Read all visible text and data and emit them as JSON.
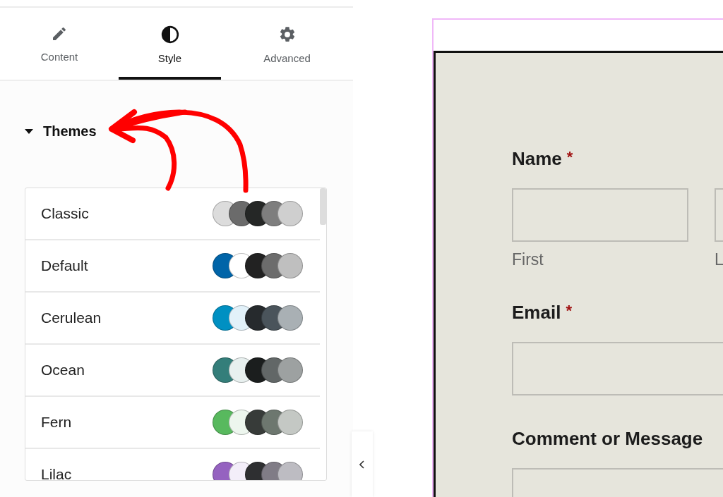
{
  "tabs": [
    {
      "label": "Content",
      "selected": false
    },
    {
      "label": "Style",
      "selected": true
    },
    {
      "label": "Advanced",
      "selected": false
    }
  ],
  "section": {
    "title": "Themes",
    "expanded": true
  },
  "themes": [
    {
      "name": "Classic",
      "swatches": [
        {
          "color": "#dcdcdc"
        },
        {
          "color": "#6b6b6b"
        },
        {
          "color": "#252726"
        },
        {
          "color": "#7e7e7e"
        },
        {
          "color": "#cfcfcf"
        }
      ]
    },
    {
      "name": "Default",
      "swatches": [
        {
          "color": "#0064a8"
        },
        {
          "color": "#ffffff"
        },
        {
          "color": "#222222"
        },
        {
          "color": "#6c6c6c"
        },
        {
          "color": "#bfbfbf"
        }
      ]
    },
    {
      "name": "Cerulean",
      "swatches": [
        {
          "color": "#0090c2"
        },
        {
          "color": "#e2f1f9"
        },
        {
          "color": "#262a2d"
        },
        {
          "color": "#4a545b"
        },
        {
          "color": "#a9b0b4"
        }
      ]
    },
    {
      "name": "Ocean",
      "swatches": [
        {
          "color": "#347e7a"
        },
        {
          "color": "#e8f0ef"
        },
        {
          "color": "#1b1e1e"
        },
        {
          "color": "#626767"
        },
        {
          "color": "#9da1a1"
        }
      ]
    },
    {
      "name": "Fern",
      "swatches": [
        {
          "color": "#58b95e"
        },
        {
          "color": "#edf6ee"
        },
        {
          "color": "#373b39"
        },
        {
          "color": "#6d776f"
        },
        {
          "color": "#c4c8c4"
        }
      ]
    },
    {
      "name": "Lilac",
      "swatches": [
        {
          "color": "#9562c0"
        },
        {
          "color": "#f3eef9"
        },
        {
          "color": "#2e2f31"
        },
        {
          "color": "#807c86"
        },
        {
          "color": "#bdbcc2"
        }
      ]
    }
  ],
  "form": {
    "fields": [
      {
        "label": "Name",
        "required_mark": "*",
        "kind": "name",
        "sublabels": [
          "First",
          "L"
        ]
      },
      {
        "label": "Email",
        "required_mark": "*",
        "kind": "text"
      },
      {
        "label": "Comment or Message",
        "kind": "text"
      }
    ]
  }
}
